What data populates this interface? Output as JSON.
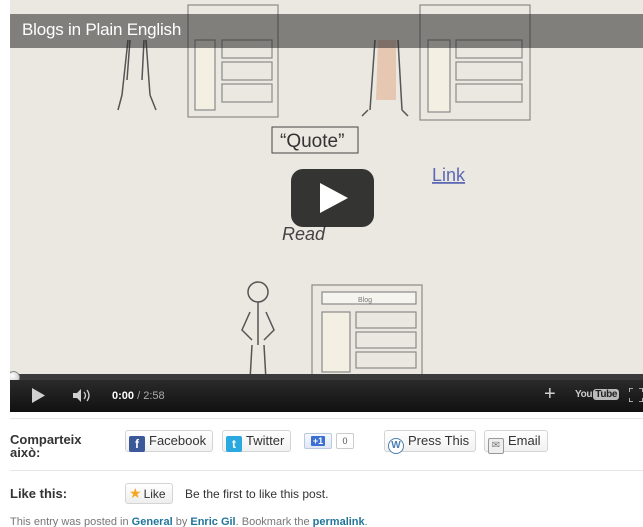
{
  "video": {
    "title": "Blogs in Plain English",
    "scene_words": {
      "quote": "“Quote”",
      "link": "Link",
      "read": "Read",
      "blog": "Blog"
    },
    "time_current": "0:00",
    "time_total": "/ 2:58",
    "progress": 0.0,
    "youtube_you": "You",
    "youtube_tube": "Tube"
  },
  "share": {
    "label": "Comparteix això:",
    "facebook": "Facebook",
    "twitter": "Twitter",
    "gplus_label": "+1",
    "gplus_count": "0",
    "pressthis": "Press This",
    "email": "Email"
  },
  "like": {
    "label": "Like this:",
    "button": "Like",
    "text": "Be the first to like this post."
  },
  "footer": {
    "prefix": "This entry was posted in ",
    "category": "General",
    "by": " by ",
    "author": "Enric Gil",
    "bookmark": ". Bookmark the ",
    "permalink": "permalink",
    "end": "."
  },
  "colors": {
    "link": "#21759b",
    "facebook": "#3b5998",
    "twitter": "#2aa9e0",
    "star": "#f5a623"
  }
}
